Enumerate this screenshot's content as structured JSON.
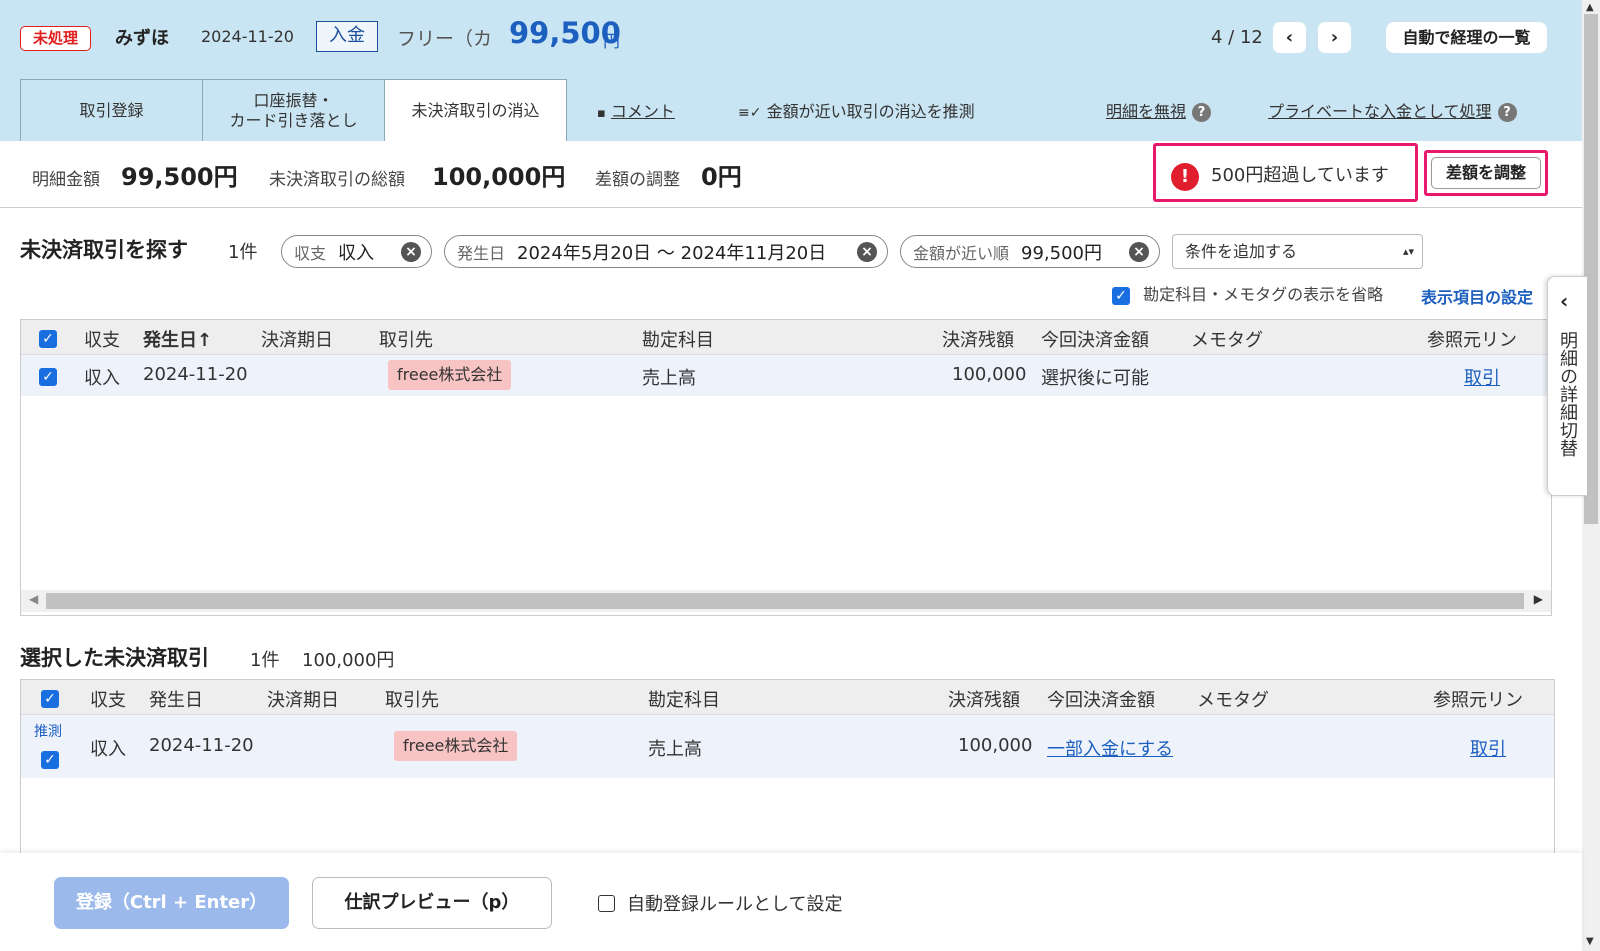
{
  "header": {
    "status": "未処理",
    "bank": "みずほ",
    "date": "2024-11-20",
    "direction": "入金",
    "counterparty": "フリー（カ",
    "amount": "99,500",
    "unit": "円",
    "pager": "4 / 12",
    "prev": "‹",
    "next": "›",
    "auto_list": "自動で経理の一覧"
  },
  "tabs": [
    {
      "label": "取引登録"
    },
    {
      "label": "口座振替・\nカード引き落とし"
    },
    {
      "label": "未決済取引の消込"
    }
  ],
  "tab_links": {
    "comment": "コメント",
    "guess": "金額が近い取引の消込を推測",
    "ignore": "明細を無視",
    "private": "プライベートな入金として処理",
    "help": "?"
  },
  "summary": {
    "detail_label": "明細金額",
    "detail_value": "99,500円",
    "unsettled_label": "未決済取引の総額",
    "unsettled_value": "100,000円",
    "diff_label": "差額の調整",
    "diff_value": "0円",
    "warning": "500円超過しています",
    "warning_icon": "!",
    "adjust_button": "差額を調整"
  },
  "search": {
    "title": "未決済取引を探す",
    "count": "1件",
    "chips": [
      {
        "label": "収支",
        "value": "収入"
      },
      {
        "label": "発生日",
        "value": "2024年5月20日 〜 2024年11月20日"
      },
      {
        "label": "金額が近い順",
        "value": "99,500円"
      }
    ],
    "chip_close": "×",
    "add_condition": "条件を追加する",
    "select_arrow": "▴▾",
    "omit_label": "勘定科目・メモタグの表示を省略",
    "settings_link": "表示項目の設定"
  },
  "table1": {
    "headers": [
      "収支",
      "発生日",
      "決済期日",
      "取引先",
      "勘定科目",
      "決済残額",
      "今回決済金額",
      "メモタグ",
      "参照元リン"
    ],
    "sort_arrow": "↑",
    "rows": [
      {
        "type": "収入",
        "date": "2024-11-20",
        "partner": "freee株式会社",
        "account": "売上高",
        "remaining": "100,000",
        "payment": "選択後に可能",
        "link": "取引"
      }
    ],
    "scroll_left": "◀",
    "scroll_right": "▶"
  },
  "selected": {
    "title": "選択した未決済取引",
    "count": "1件",
    "total": "100,000円"
  },
  "table2": {
    "headers": [
      "収支",
      "発生日",
      "決済期日",
      "取引先",
      "勘定科目",
      "決済残額",
      "今回決済金額",
      "メモタグ",
      "参照元リン"
    ],
    "rows": [
      {
        "guess": "推測",
        "type": "収入",
        "date": "2024-11-20",
        "partner": "freee株式会社",
        "account": "売上高",
        "remaining": "100,000",
        "payment": "一部入金にする",
        "link": "取引"
      }
    ]
  },
  "side_panel": {
    "chevron": "‹",
    "label": "明細の詳細切替"
  },
  "footer": {
    "register": "登録（Ctrl + Enter）",
    "preview": "仕訳プレビュー（p）",
    "auto_rule": "自動登録ルールとして設定"
  },
  "colors": {
    "header_bg": "#c9e4f2",
    "accent_blue": "#1d5fbf",
    "highlight_pink": "#e8186d",
    "tag_bg": "#f7c3c3",
    "checkbox": "#1a6fe0"
  }
}
